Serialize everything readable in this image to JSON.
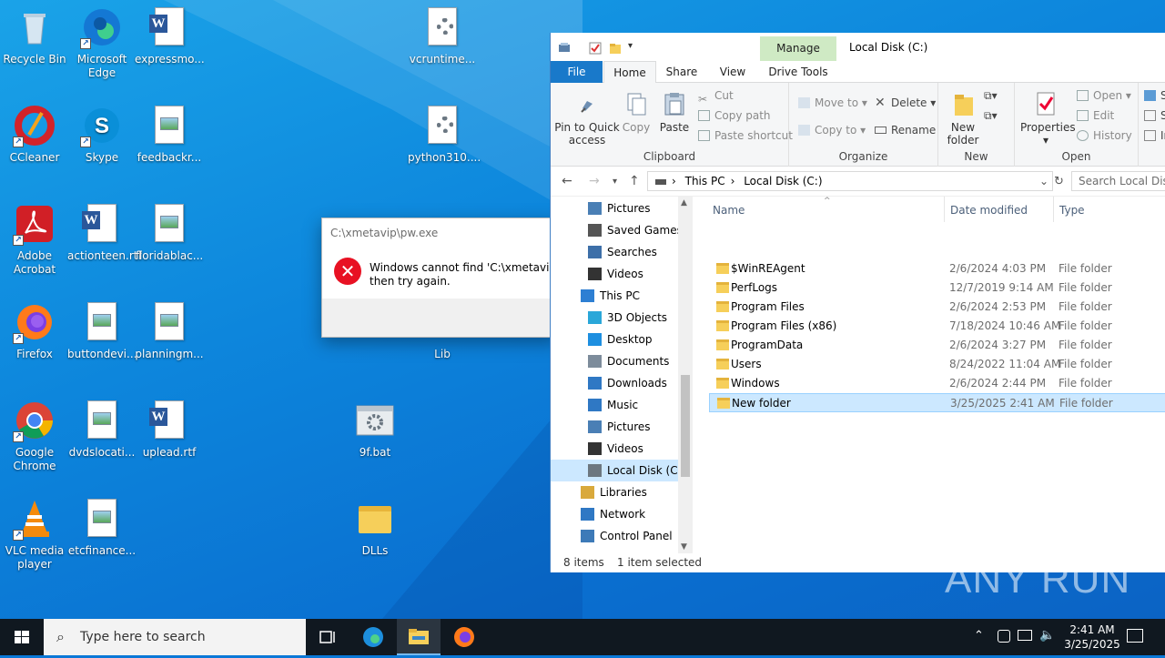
{
  "desktop": {
    "icons": [
      {
        "label": "Recycle Bin",
        "icon": "recycle-bin-icon"
      },
      {
        "label": "Microsoft Edge",
        "icon": "edge-icon"
      },
      {
        "label": "expressmo...",
        "icon": "word-doc-icon"
      },
      {
        "label": "vcruntime...",
        "icon": "gear-file-icon"
      },
      {
        "label": "CCleaner",
        "icon": "ccleaner-icon"
      },
      {
        "label": "Skype",
        "icon": "skype-icon"
      },
      {
        "label": "feedbackr...",
        "icon": "image-file-icon"
      },
      {
        "label": "python310....",
        "icon": "gear-file-icon"
      },
      {
        "label": "Adobe Acrobat",
        "icon": "acrobat-icon"
      },
      {
        "label": "actionteen.rtf",
        "icon": "word-doc-icon"
      },
      {
        "label": "floridablac...",
        "icon": "image-file-icon"
      },
      {
        "label": "Firefox",
        "icon": "firefox-icon"
      },
      {
        "label": "buttondevi...",
        "icon": "image-file-icon"
      },
      {
        "label": "planningm...",
        "icon": "image-file-icon"
      },
      {
        "label": "Lib",
        "icon": "folder-icon"
      },
      {
        "label": "Google Chrome",
        "icon": "chrome-icon"
      },
      {
        "label": "dvdslocati...",
        "icon": "image-file-icon"
      },
      {
        "label": "uplead.rtf",
        "icon": "word-doc-icon"
      },
      {
        "label": "9f.bat",
        "icon": "batch-file-icon"
      },
      {
        "label": "VLC media player",
        "icon": "vlc-icon"
      },
      {
        "label": "etcfinance...",
        "icon": "image-file-icon"
      },
      {
        "label": "DLLs",
        "icon": "folder-icon"
      }
    ]
  },
  "dialog": {
    "title": "C:\\xmetavip\\pw.exe",
    "message_line1": "Windows cannot find 'C:\\xmetavip\\pw",
    "message_line2": "then try again."
  },
  "explorer": {
    "manage_label": "Manage",
    "title": "Local Disk (C:)",
    "tabs": {
      "file": "File",
      "home": "Home",
      "share": "Share",
      "view": "View",
      "drive_tools": "Drive Tools"
    },
    "ribbon": {
      "pin": "Pin to Quick access",
      "copy": "Copy",
      "paste": "Paste",
      "cut": "Cut",
      "copy_path": "Copy path",
      "paste_shortcut": "Paste shortcut",
      "clipboard": "Clipboard",
      "move_to": "Move to",
      "copy_to": "Copy to",
      "delete": "Delete",
      "rename": "Rename",
      "organize": "Organize",
      "new_folder": "New folder",
      "new": "New",
      "properties": "Properties",
      "open": "Open",
      "edit": "Edit",
      "history": "History",
      "open_group": "Open",
      "select_1": "S",
      "select_2": "S",
      "select_3": "Ir"
    },
    "address": {
      "this_pc": "This PC",
      "location": "Local Disk (C:)",
      "search_placeholder": "Search Local Disk (C:)"
    },
    "nav": [
      {
        "label": "Pictures",
        "icon": "pictures-icon",
        "indent": 2
      },
      {
        "label": "Saved Games",
        "icon": "saved-games-icon",
        "indent": 2
      },
      {
        "label": "Searches",
        "icon": "search-icon",
        "indent": 2
      },
      {
        "label": "Videos",
        "icon": "videos-icon",
        "indent": 2
      },
      {
        "label": "This PC",
        "icon": "this-pc-icon",
        "indent": 1
      },
      {
        "label": "3D Objects",
        "icon": "3d-objects-icon",
        "indent": 2
      },
      {
        "label": "Desktop",
        "icon": "desktop-icon",
        "indent": 2
      },
      {
        "label": "Documents",
        "icon": "documents-icon",
        "indent": 2
      },
      {
        "label": "Downloads",
        "icon": "downloads-icon",
        "indent": 2
      },
      {
        "label": "Music",
        "icon": "music-icon",
        "indent": 2
      },
      {
        "label": "Pictures",
        "icon": "pictures-icon",
        "indent": 2
      },
      {
        "label": "Videos",
        "icon": "videos-icon",
        "indent": 2
      },
      {
        "label": "Local Disk (C:)",
        "icon": "drive-icon",
        "indent": 2,
        "selected": true
      },
      {
        "label": "Libraries",
        "icon": "libraries-icon",
        "indent": 1
      },
      {
        "label": "Network",
        "icon": "network-icon",
        "indent": 1
      },
      {
        "label": "Control Panel",
        "icon": "control-panel-icon",
        "indent": 1
      }
    ],
    "columns": {
      "name": "Name",
      "date": "Date modified",
      "type": "Type"
    },
    "rows": [
      {
        "name": "$WinREAgent",
        "date": "2/6/2024 4:03 PM",
        "type": "File folder"
      },
      {
        "name": "PerfLogs",
        "date": "12/7/2019 9:14 AM",
        "type": "File folder"
      },
      {
        "name": "Program Files",
        "date": "2/6/2024 2:53 PM",
        "type": "File folder"
      },
      {
        "name": "Program Files (x86)",
        "date": "7/18/2024 10:46 AM",
        "type": "File folder"
      },
      {
        "name": "ProgramData",
        "date": "2/6/2024 3:27 PM",
        "type": "File folder"
      },
      {
        "name": "Users",
        "date": "8/24/2022 11:04 AM",
        "type": "File folder"
      },
      {
        "name": "Windows",
        "date": "2/6/2024 2:44 PM",
        "type": "File folder"
      },
      {
        "name": "New folder",
        "date": "3/25/2025 2:41 AM",
        "type": "File folder",
        "selected": true
      }
    ],
    "status": {
      "items": "8 items",
      "selected": "1 item selected"
    }
  },
  "taskbar": {
    "search_placeholder": "Type here to search",
    "time": "2:41 AM",
    "date": "3/25/2025"
  },
  "watermark": "ANY RUN"
}
